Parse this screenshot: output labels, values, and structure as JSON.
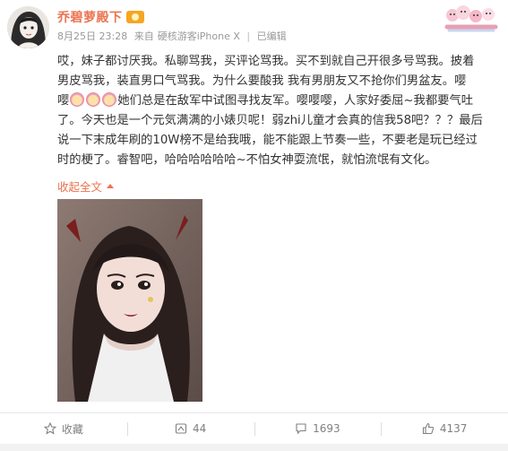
{
  "user": {
    "name": "乔碧萝殿下",
    "timestamp": "8月25日 23:28",
    "source_prefix": "来自",
    "source_device": "硬核游客iPhone X",
    "edited": "已编辑"
  },
  "post": {
    "text_lines": [
      "哎，妹子都讨厌我。私聊骂我，买评论骂我。买不到就自己开很多号骂我。披着",
      "男皮骂我，装直男口气骂我。为什么要酸我   我有男朋友又不抢你们男盆友。嘤",
      "她们总是在敌军中试图寻找友军。嘤嘤嘤，人家好委屈~我都要气吐",
      "了。今天也是一个元気满满的小婊贝呢！弱zhi儿童才会真的信我58吧？？？最后",
      "说一下末成年刷的10W榜不是给我哦，能不能跟上节奏一些，不要老是玩已经过",
      "时的梗了。睿智吧，哈哈哈哈哈哈~不怕女神耍流氓，就怕流氓有文化。"
    ],
    "line3_prefix": "嘤",
    "collapse_label": "收起全文"
  },
  "actions": {
    "favorite": "收藏",
    "repost": "44",
    "comment": "1693",
    "like": "4137"
  },
  "icons": {
    "avatar": "avatar-drawing",
    "vip": "vip-badge-icon",
    "sticker": "cartoon-sticker",
    "emoji": "crying-face-emoji",
    "favorite": "star-icon",
    "repost": "repost-icon",
    "comment": "comment-icon",
    "like": "thumbs-up-icon"
  },
  "colors": {
    "accent": "#eb7350",
    "meta": "#999999",
    "text": "#333333"
  }
}
